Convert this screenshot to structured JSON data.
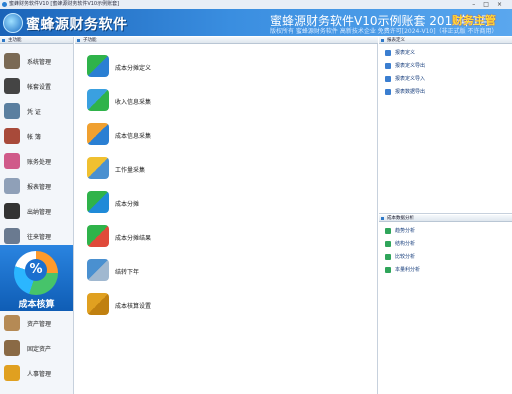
{
  "window": {
    "title": "蜜蜂财务软件V10 [蜜蜂源财务软件V10示例账套]"
  },
  "banner": {
    "logo_text": "蜜蜂源财务软件",
    "product": "蜜蜂源财务软件V10示例账套  2016年1月",
    "role": "财务主管",
    "license": "版权所有  蜜蜂源财务软件  高新技术企业  免费许可[2024-V10]（非正式版  不许商用）"
  },
  "sidebar": {
    "header": "主功能",
    "items": [
      {
        "label": "系统管理",
        "icon": "system-icon",
        "color": "#7a6a55"
      },
      {
        "label": "帐套设置",
        "icon": "book-settings-icon",
        "color": "#444444"
      },
      {
        "label": "凭   证",
        "icon": "voucher-icon",
        "color": "#5a7fa0"
      },
      {
        "label": "帐   簿",
        "icon": "ledger-icon",
        "color": "#a84a3a"
      },
      {
        "label": "账务处理",
        "icon": "accounting-icon",
        "color": "#d05a8a"
      },
      {
        "label": "报表管理",
        "icon": "report-icon",
        "color": "#8fa0b8"
      },
      {
        "label": "出纳管理",
        "icon": "cashier-icon",
        "color": "#333333"
      },
      {
        "label": "往来管理",
        "icon": "contacts-icon",
        "color": "#6a7a90"
      }
    ],
    "active": {
      "label": "成本核算",
      "icon": "cost-accounting-icon"
    },
    "bottom_items": [
      {
        "label": "资产管理",
        "icon": "asset-icon",
        "color": "#b58a55"
      },
      {
        "label": "固定资产",
        "icon": "fixed-asset-icon",
        "color": "#8a6a45"
      },
      {
        "label": "人事管理",
        "icon": "hr-icon",
        "color": "#e0a020"
      }
    ]
  },
  "main": {
    "header": "子功能",
    "functions": [
      {
        "label": "成本分摊定义",
        "icon": "allocation-define-icon",
        "c1": "#2fb34a",
        "c2": "#2a7fd3"
      },
      {
        "label": "收入信息采集",
        "icon": "income-collect-icon",
        "c1": "#3aa0e0",
        "c2": "#2fb34a"
      },
      {
        "label": "成本信息采集",
        "icon": "cost-collect-icon",
        "c1": "#f0a030",
        "c2": "#2a7fd3"
      },
      {
        "label": "工作量采集",
        "icon": "workload-collect-icon",
        "c1": "#f0c030",
        "c2": "#4a90d0"
      },
      {
        "label": "成本分摊",
        "icon": "cost-allocation-icon",
        "c1": "#2fb34a",
        "c2": "#1f8ad8"
      },
      {
        "label": "成本分摊结果",
        "icon": "allocation-result-icon",
        "c1": "#2fb34a",
        "c2": "#e04a3a"
      },
      {
        "label": "结转下年",
        "icon": "carry-forward-icon",
        "c1": "#4a90d0",
        "c2": "#a0b8d0"
      },
      {
        "label": "成本核算设置",
        "icon": "cost-settings-icon",
        "c1": "#e0a020",
        "c2": "#c08010"
      }
    ]
  },
  "report_panel": {
    "header": "报表定义",
    "items": [
      {
        "label": "报表定义",
        "icon": "report-define-icon"
      },
      {
        "label": "报表定义导出",
        "icon": "report-export-icon"
      },
      {
        "label": "报表定义导入",
        "icon": "report-import-icon"
      },
      {
        "label": "报表数据导出",
        "icon": "report-data-export-icon"
      }
    ]
  },
  "analysis_panel": {
    "header": "成本数据分析",
    "items": [
      {
        "label": "趋势分析",
        "icon": "trend-analysis-icon"
      },
      {
        "label": "结构分析",
        "icon": "structure-analysis-icon"
      },
      {
        "label": "比较分析",
        "icon": "compare-analysis-icon"
      },
      {
        "label": "本量利分析",
        "icon": "cvp-analysis-icon"
      }
    ]
  }
}
